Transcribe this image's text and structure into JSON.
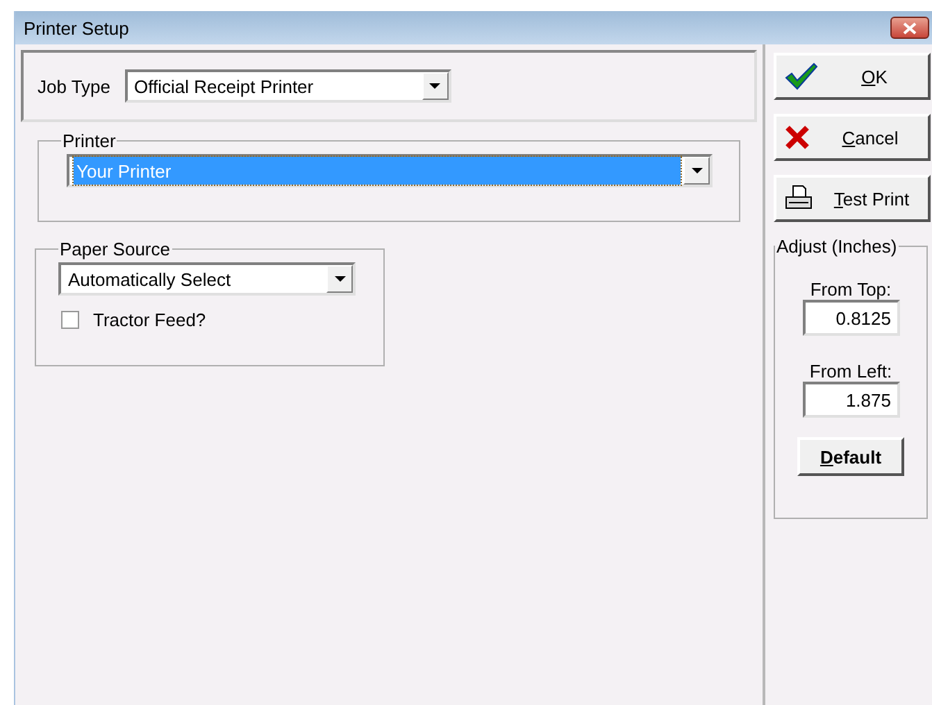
{
  "window": {
    "title": "Printer Setup"
  },
  "job_type": {
    "label": "Job Type",
    "value": "Official Receipt Printer"
  },
  "printer": {
    "legend": "Printer",
    "value": "Your Printer",
    "selected": true
  },
  "paper_source": {
    "legend": "Paper Source",
    "value": "Automatically Select"
  },
  "tractor_feed": {
    "label": "Tractor Feed?",
    "checked": false
  },
  "buttons": [
    {
      "label": "OK",
      "kind": "ok"
    },
    {
      "label": "Cancel",
      "kind": "cancel"
    },
    {
      "label": "Test Print",
      "kind": "print"
    }
  ],
  "adjust": {
    "legend": "Adjust (Inches)",
    "fields": [
      {
        "label": "From Top:",
        "value": "0.8125"
      },
      {
        "label": "From Left:",
        "value": "1.875"
      }
    ],
    "default_button": "Default"
  }
}
